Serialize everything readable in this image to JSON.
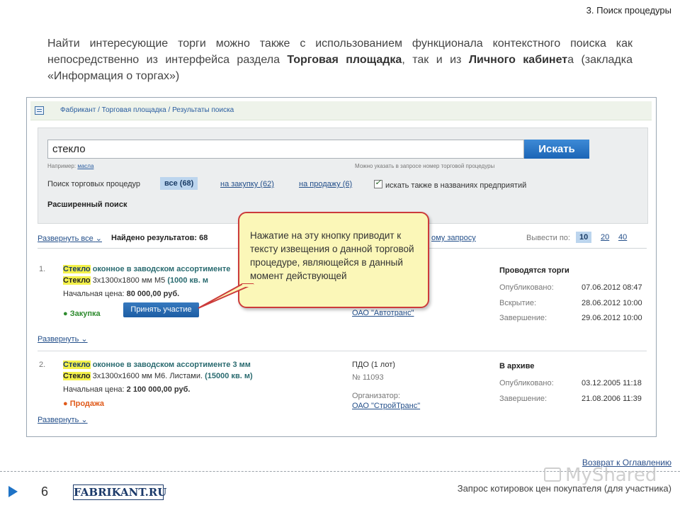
{
  "slide": {
    "title": "3. Поиск процедуры",
    "intro_part1": "Найти интересующие торги можно также с использованием функционала контекстного поиска как непосредственно из интерфейса раздела ",
    "intro_bold1": "Торговая площадка",
    "intro_part2": ", так и из ",
    "intro_bold2": "Личного кабинет",
    "intro_part3": "а (закладка «Информация о торгах»)"
  },
  "app": {
    "breadcrumbs": "Фабрикант / Торговая площадка / Результаты поиска",
    "search": {
      "value": "стекло",
      "button": "Искать",
      "hint_prefix": "Например: ",
      "hint_example": "масла",
      "hint_right": "Можно указать в запросе номер торговой процедуры"
    },
    "filters": {
      "label": "Поиск торговых процедур",
      "all": "все (68)",
      "purchase": "на закупку (62)",
      "sale": "на продажу (6)",
      "also_names": "искать также в названиях предприятий"
    },
    "advanced": "Расширенный поиск",
    "results_bar": {
      "expand_all": "Развернуть все",
      "found_label": "Найдено результатов:",
      "found_count": "68",
      "query_link_tail": "ому запросу",
      "show_by": "Вывести по:",
      "pages": [
        "10",
        "20",
        "40"
      ]
    },
    "results": [
      {
        "num": "1.",
        "title_hl": "Стекло",
        "title_rest": " оконное в заводском ассортименте",
        "sub_hl": "Стекло",
        "sub_rest": " 3х1300х1800 мм М5",
        "sub_qty": "(1000 кв. м",
        "price_label": "Начальная цена:",
        "price": "80 000,00 руб.",
        "type": "Закупка",
        "action": "Принять участие",
        "organizer": "ОАО \"Автотранс\"",
        "status": "Проводятся торги",
        "dates": [
          {
            "label": "Опубликовано:",
            "value": "07.06.2012 08:47"
          },
          {
            "label": "Вскрытие:",
            "value": "28.06.2012 10:00"
          },
          {
            "label": "Завершение:",
            "value": "29.06.2012 10:00"
          }
        ],
        "expand": "Развернуть"
      },
      {
        "num": "2.",
        "title_hl": "Стекло",
        "title_rest": " оконное в заводском ассортименте 3 мм",
        "sub_hl": "Стекло",
        "sub_rest": " 3х1300х1600 мм М6. Листами.",
        "sub_qty": "(15000 кв. м)",
        "price_label": "Начальная цена:",
        "price": "2 100 000,00 руб.",
        "type": "Продажа",
        "proc_type": "ПДО (1 лот)",
        "proc_num": "№ 11093",
        "organizer_label": "Организатор:",
        "organizer": "ОАО \"СтройТранс\"",
        "status": "В архиве",
        "dates": [
          {
            "label": "Опубликовано:",
            "value": "03.12.2005 11:18"
          },
          {
            "label": "Завершение:",
            "value": "21.08.2006 11:39"
          }
        ],
        "expand": "Развернуть"
      }
    ]
  },
  "callout": {
    "text": "Нажатие на эту кнопку приводит к тексту извещения о данной торговой процедуре, являющейся в данный момент действующей"
  },
  "footer": {
    "back_link": "Возврат к Оглавлению",
    "page_number": "6",
    "logo": "FABRIKANT.RU",
    "text": "Запрос котировок цен покупателя (для участника)",
    "watermark": "MyShared"
  }
}
